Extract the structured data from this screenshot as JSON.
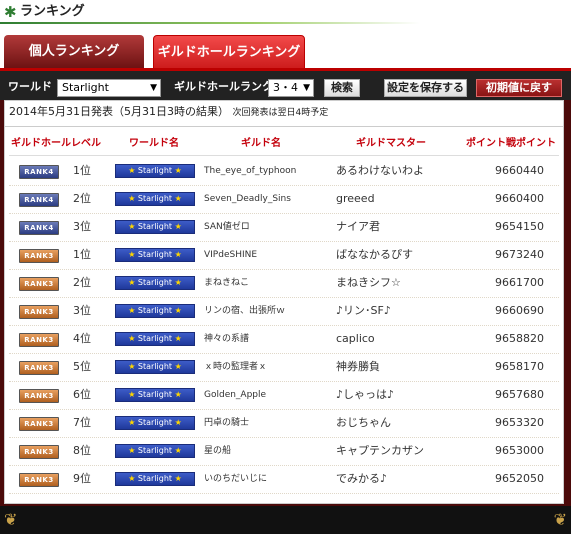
{
  "header": {
    "title": "ランキング",
    "icon": "leaf-icon"
  },
  "tabs": [
    {
      "label": "個人ランキング",
      "active": false
    },
    {
      "label": "ギルドホールランキング",
      "active": true
    }
  ],
  "toolbar": {
    "world_label": "ワールド",
    "world_value": "Starlight",
    "rank_label": "ギルドホールランク",
    "rank_value": "3・4",
    "search_button": "検索",
    "save_button": "設定を保存する",
    "reset_button": "初期値に戻す"
  },
  "announcement": {
    "main": "2014年5月31日発表（5月31日3時の結果）",
    "note": "次回発表は翌日4時予定"
  },
  "columns": [
    "ギルドホールレベル",
    "ワールド名",
    "ギルド名",
    "ギルドマスター",
    "ポイント戦ポイント"
  ],
  "world_badge": "Starlight",
  "rows": [
    {
      "rank_badge": "RANK4",
      "position": "1位",
      "guild": "The_eye_of_typhoon",
      "master": "あるわけないわよ",
      "points": "9660440",
      "level": 4
    },
    {
      "rank_badge": "RANK4",
      "position": "2位",
      "guild": "Seven_Deadly_Sins",
      "master": "greeed",
      "points": "9660400",
      "level": 4
    },
    {
      "rank_badge": "RANK4",
      "position": "3位",
      "guild": "SAN値ゼロ",
      "master": "ナイア君",
      "points": "9654150",
      "level": 4
    },
    {
      "rank_badge": "RANK3",
      "position": "1位",
      "guild": "VIPdeSHINE",
      "master": "ばななかるぴす",
      "points": "9673240",
      "level": 3
    },
    {
      "rank_badge": "RANK3",
      "position": "2位",
      "guild": "まねきねこ",
      "master": "まねきシフ☆",
      "points": "9661700",
      "level": 3
    },
    {
      "rank_badge": "RANK3",
      "position": "3位",
      "guild": "リンの宿、出張所ｗ",
      "master": "♪リン･SF♪",
      "points": "9660690",
      "level": 3
    },
    {
      "rank_badge": "RANK3",
      "position": "4位",
      "guild": "神々の系譜",
      "master": "caplico",
      "points": "9658820",
      "level": 3
    },
    {
      "rank_badge": "RANK3",
      "position": "5位",
      "guild": "ｘ時の監理者ｘ",
      "master": "神券勝負",
      "points": "9658170",
      "level": 3
    },
    {
      "rank_badge": "RANK3",
      "position": "6位",
      "guild": "Golden_Apple",
      "master": "♪しゃっは♪",
      "points": "9657680",
      "level": 3
    },
    {
      "rank_badge": "RANK3",
      "position": "7位",
      "guild": "円卓の騎士",
      "master": "おじちゃん",
      "points": "9653320",
      "level": 3
    },
    {
      "rank_badge": "RANK3",
      "position": "8位",
      "guild": "星の船",
      "master": "キャプテンカザン",
      "points": "9653000",
      "level": 3
    },
    {
      "rank_badge": "RANK3",
      "position": "9位",
      "guild": "いのちだいじに",
      "master": "でみかる♪",
      "points": "9652050",
      "level": 3
    }
  ],
  "colors": {
    "accent_red": "#c4000b",
    "world_blue": "#2b47b5",
    "rank4": "#3a4b92",
    "rank3": "#c6722c"
  }
}
